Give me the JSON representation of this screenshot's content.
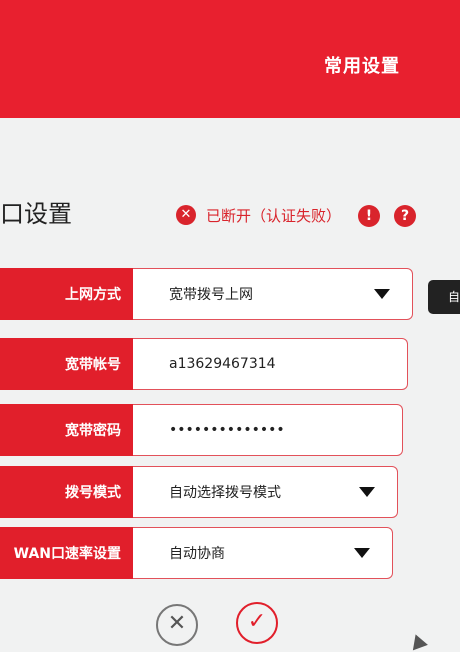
{
  "header": {
    "title": "常用设置"
  },
  "section": {
    "title": "口设置"
  },
  "status": {
    "icon": "x-circle-icon",
    "text": "已断开（认证失败）"
  },
  "form": {
    "rows": [
      {
        "label": "上网方式",
        "value": "宽带拨号上网",
        "type": "select"
      },
      {
        "label": "宽带帐号",
        "value": "a13629467314",
        "type": "text"
      },
      {
        "label": "宽带密码",
        "value": "••••••••••••••",
        "type": "password"
      },
      {
        "label": "拨号模式",
        "value": "自动选择拨号模式",
        "type": "select"
      },
      {
        "label": "WAN口速率设置",
        "value": "自动协商",
        "type": "select"
      }
    ],
    "side_button": "自"
  },
  "colors": {
    "brand_red": "#e8202f",
    "label_red": "#e11f2b",
    "status_red": "#d9242c"
  }
}
